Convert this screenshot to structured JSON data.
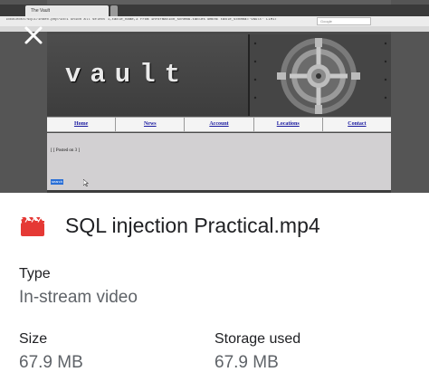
{
  "preview": {
    "browser_tab_title": "The Vault",
    "url": "localhost/sqli/index.php?id=1 union all select 1,table_name,3 from information_schema.tables WHERE table_schema='vault' LIMIT 1,1",
    "search_placeholder": "Google",
    "site_title": "vault",
    "nav_items": [
      "Home",
      "News",
      "Account",
      "Locations",
      "Contact"
    ],
    "posted_text": "[ [ Posted on 3 ]",
    "search_chip_label": "search"
  },
  "file": {
    "icon": "video-file-icon",
    "icon_color": "#e53935",
    "name": "SQL injection Practical.mp4"
  },
  "details": {
    "type_label": "Type",
    "type_value": "In-stream video",
    "size_label": "Size",
    "size_value": "67.9 MB",
    "storage_label": "Storage used",
    "storage_value": "67.9 MB"
  }
}
